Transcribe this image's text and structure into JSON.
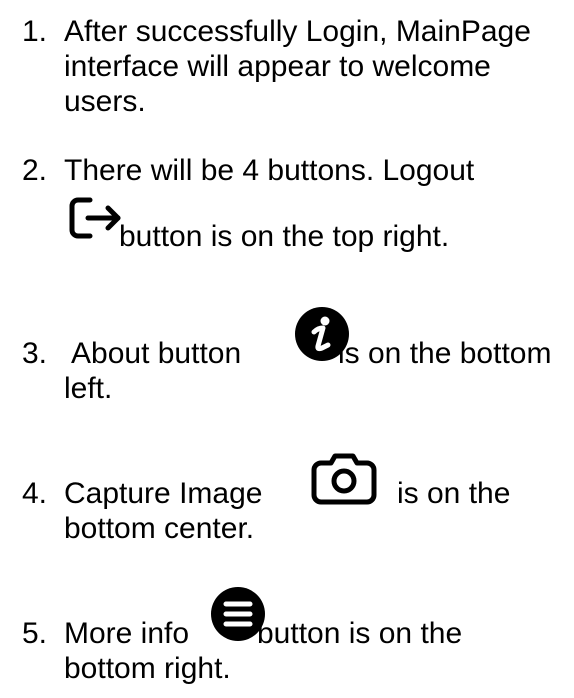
{
  "items": [
    {
      "number": "1.",
      "lines": [
        "After successfully Login, MainPage",
        "interface will appear to welcome",
        "users."
      ]
    },
    {
      "number": "2.",
      "line1": "There will be 4 buttons. Logout",
      "icon": "logout-icon",
      "line2": "button is on the top right."
    },
    {
      "number": "3.",
      "before": "About button",
      "icon": "info-circle-icon",
      "after": "is on the bottom",
      "line2": "left."
    },
    {
      "number": "4.",
      "before": "Capture Image",
      "icon": "camera-icon",
      "after": "is on the",
      "line2": "bottom center."
    },
    {
      "number": "5.",
      "before": "More info",
      "icon": "menu-circle-icon",
      "after": "button is on the",
      "line2": "bottom right."
    }
  ]
}
